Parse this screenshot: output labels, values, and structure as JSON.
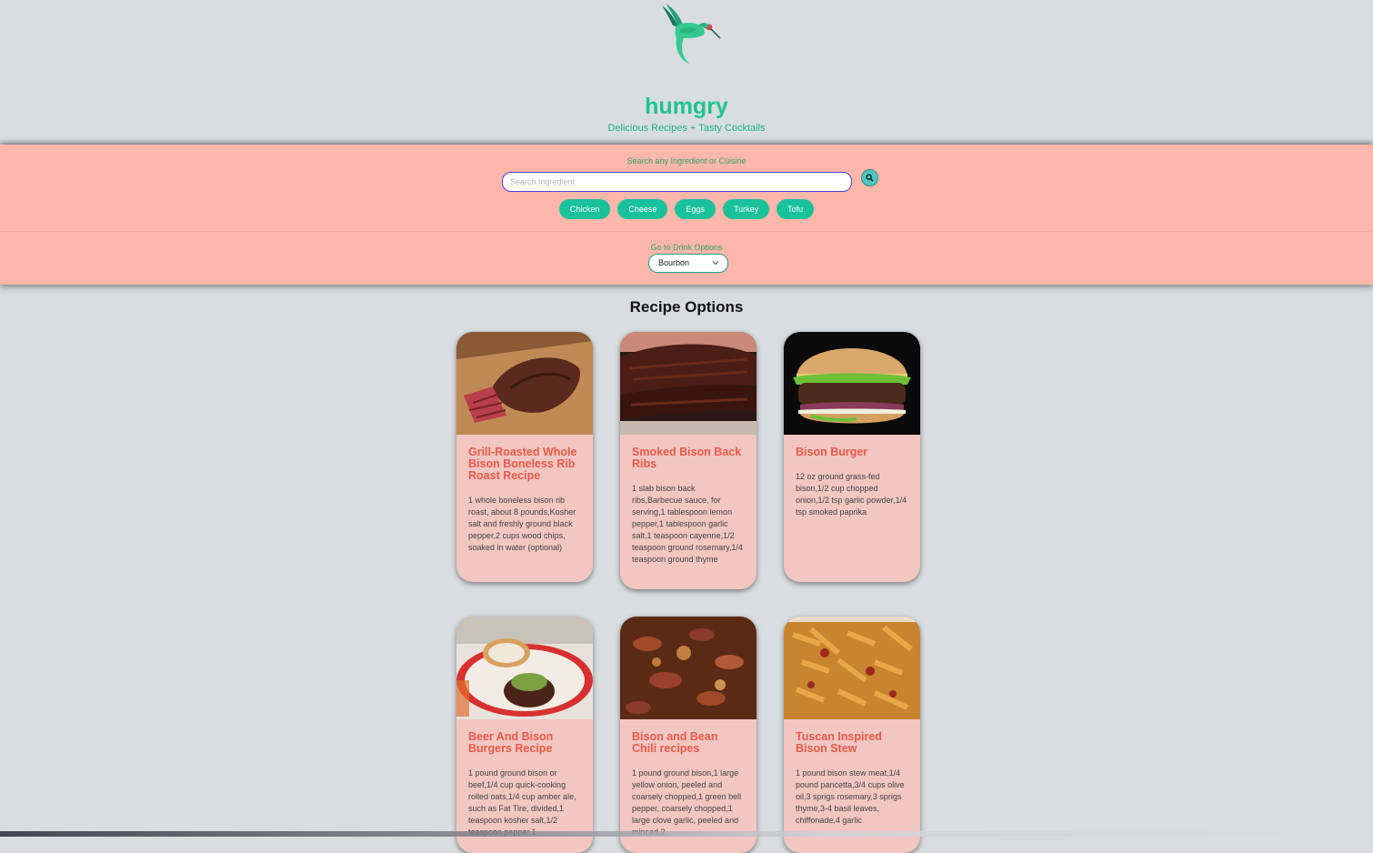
{
  "brand": {
    "name": "humgry",
    "tagline": "Delicious Recipes + Tasty Cocktails"
  },
  "search": {
    "label": "Search any Ingredient or Cuisine",
    "placeholder": "Search Ingredient",
    "chips": [
      "Chicken",
      "Cheese",
      "Eggs",
      "Turkey",
      "Tofu"
    ]
  },
  "drinks": {
    "label": "Go to Drink Options",
    "selected": "Bourbon"
  },
  "section_title": "Recipe Options",
  "recipes": [
    {
      "title": "Grill-Roasted Whole Bison Boneless Rib Roast Recipe",
      "ingredients": "1 whole boneless bison rib roast, about 8 pounds,Kosher salt and freshly ground black pepper,2 cups wood chips, soaked in water (optional)"
    },
    {
      "title": "Smoked Bison Back Ribs",
      "ingredients": "1 slab bison back ribs,Barbecue sauce, for serving,1 tablespoon lemon pepper,1 tablespoon garlic salt,1 teaspoon cayenne,1/2 teaspoon ground rosemary,1/4 teaspoon ground thyme"
    },
    {
      "title": "Bison Burger",
      "ingredients": "12 oz ground grass-fed bison,1/2 cup chopped onion,1/2 tsp garlic powder,1/4 tsp smoked paprika"
    },
    {
      "title": "Beer And Bison Burgers Recipe",
      "ingredients": "1 pound ground bison or beef,1/4 cup quick-cooking rolled oats,1/4 cup amber ale, such as Fat Tire, divided,1 teaspoon kosher salt,1/2 teaspoon pepper,1"
    },
    {
      "title": "Bison and Bean Chili recipes",
      "ingredients": "1 pound ground bison,1 large yellow onion, peeled and coarsely chopped,1 green bell pepper, coarsely chopped,1 large clove garlic, peeled and minced,2"
    },
    {
      "title": "Tuscan Inspired Bison Stew",
      "ingredients": "1 pound bison stew meat,1/4 pound pancetta,3/4 cups olive oil,3 sprigs rosemary,3 sprigs thyme,3-4 basil leaves, chiffonade,4 garlic"
    }
  ]
}
